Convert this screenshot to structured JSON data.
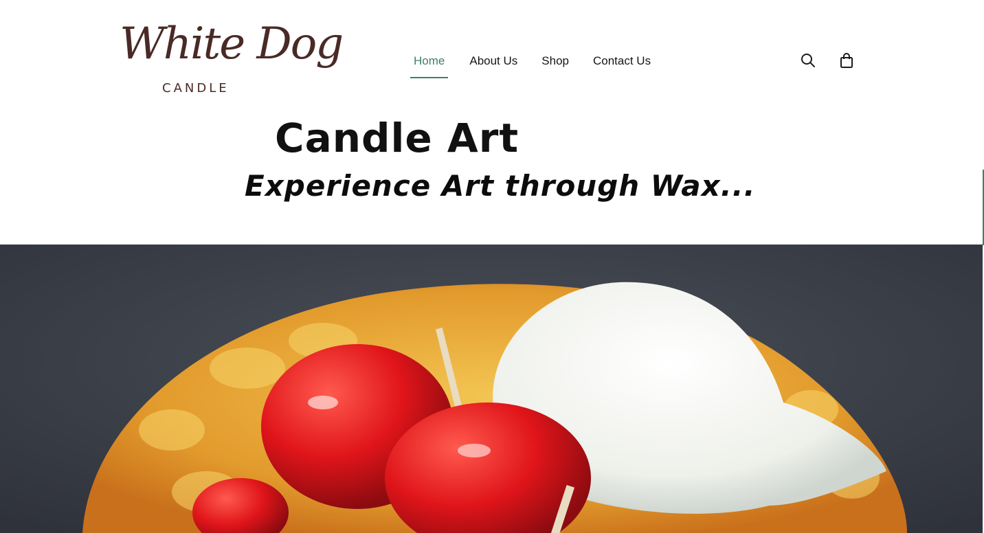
{
  "brand": {
    "logo_script": "White Dog",
    "logo_subtitle": "CANDLE",
    "color": "#4a2a26"
  },
  "nav": {
    "items": [
      {
        "label": "Home",
        "active": true
      },
      {
        "label": "About Us",
        "active": false
      },
      {
        "label": "Shop",
        "active": false
      },
      {
        "label": "Contact Us",
        "active": false
      }
    ],
    "active_color": "#3d7f69"
  },
  "header_icons": {
    "search": "search-icon",
    "cart": "shopping-bag-icon"
  },
  "hero_text": {
    "title": "Candle Art",
    "subtitle": "Experience Art through Wax..."
  },
  "hero_image": {
    "subject": "waffle-bowl-candle-with-cherries-and-ice-cream"
  }
}
